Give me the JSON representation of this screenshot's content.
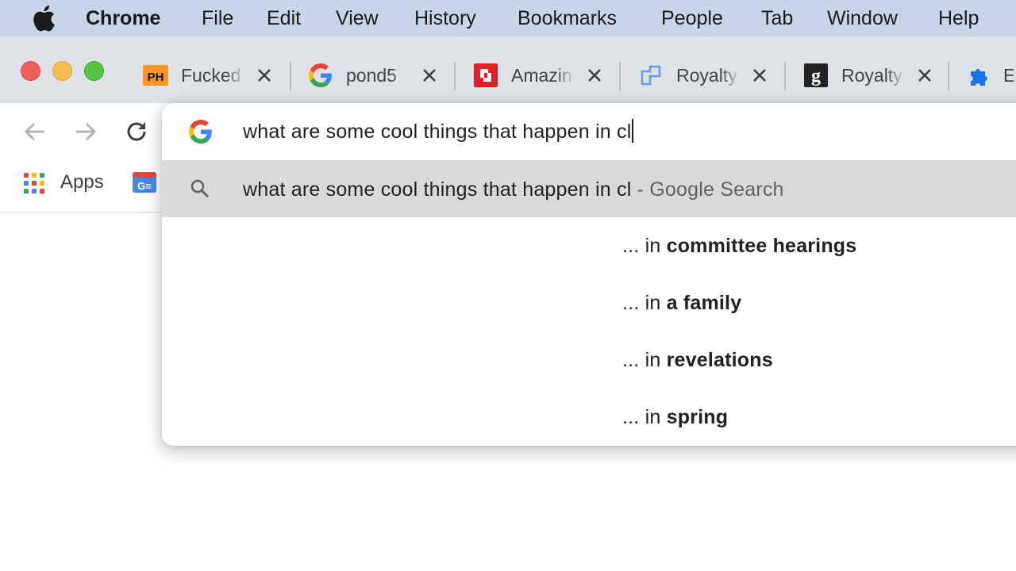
{
  "menubar": {
    "app_name": "Chrome",
    "items": [
      "File",
      "Edit",
      "View",
      "History",
      "Bookmarks",
      "People",
      "Tab",
      "Window",
      "Help"
    ]
  },
  "window_controls": {
    "close_color": "#ee5e56",
    "minimize_color": "#f5be4f",
    "zoom_color": "#58c443"
  },
  "tabs": [
    {
      "title": "Fucked",
      "favicon": "ph-icon"
    },
    {
      "title": "pond5",
      "favicon": "google-g-icon"
    },
    {
      "title": "Amazing",
      "favicon": "shutterstock-icon"
    },
    {
      "title": "Royalty",
      "favicon": "pond-flag-icon"
    },
    {
      "title": "Royalty",
      "favicon": "g-letter-icon"
    },
    {
      "title": "E",
      "favicon": "puzzle-icon"
    }
  ],
  "bookmarks": {
    "apps_label": "Apps"
  },
  "omnibox": {
    "input_value": "what are some cool things that happen in cl",
    "selected_suggestion": {
      "text": "what are some cool things that happen in cl",
      "suffix": "- Google Search"
    },
    "suggestions": [
      {
        "prefix": "... in ",
        "completion": "committee hearings"
      },
      {
        "prefix": "... in ",
        "completion": "a family"
      },
      {
        "prefix": "... in ",
        "completion": "revelations"
      },
      {
        "prefix": "... in ",
        "completion": "spring"
      }
    ]
  },
  "colors": {
    "menubar_bg": "#c7d5e6",
    "tabstrip_bg": "#dee1e6",
    "selected_row_bg": "#d9d9d9",
    "google_blue": "#4285f4",
    "google_red": "#ea4335",
    "google_yellow": "#fbbc05",
    "google_green": "#34a853"
  }
}
